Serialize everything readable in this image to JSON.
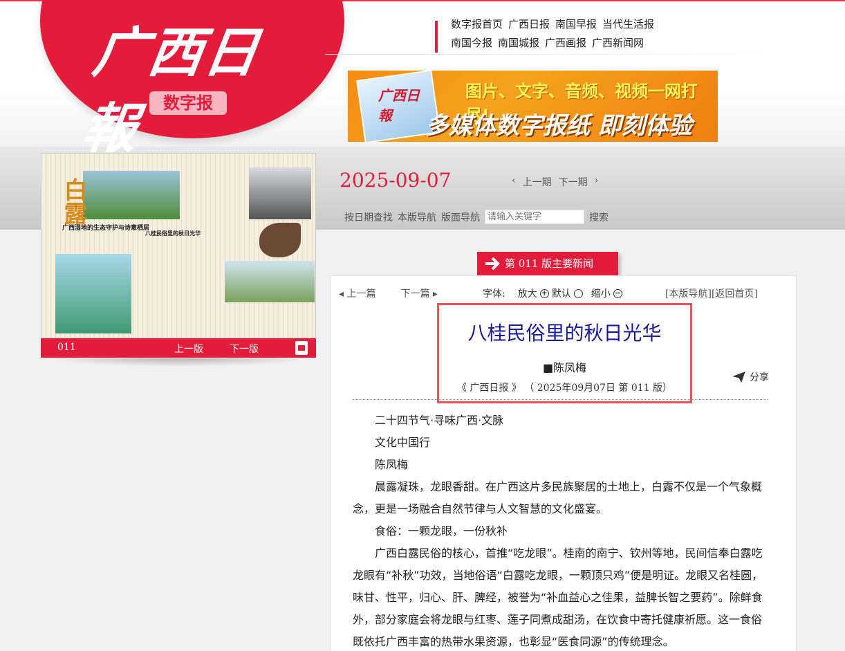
{
  "logo": {
    "title": "广西日報",
    "badge": "数字报"
  },
  "nav": {
    "row1": [
      "数字报首页",
      "广西日报",
      "南国早报",
      "当代生活报"
    ],
    "row2": [
      "南国今报",
      "南国城报",
      "广西画报",
      "广西新闻网"
    ]
  },
  "banner": {
    "mark": "广西日報",
    "line1": "图片、文字、音频、视频一网打尽!",
    "line2": "多媒体数字报纸  即刻体验"
  },
  "thumbnail": {
    "headline": "广西湿地的生态守护与诗意栖居",
    "subheadline": "八桂民俗里的秋日光华",
    "seasonal_char": "白露",
    "page_no": "011",
    "prev_label": "上一版",
    "next_label": "下一版"
  },
  "date": "2025-09-07",
  "period_nav": {
    "prev": "上一期",
    "next": "下一期"
  },
  "search": {
    "by_date": "按日期查找",
    "this_page": "本版导航",
    "page_nav": "版面导航",
    "placeholder": "请输入关键字",
    "button": "搜索"
  },
  "edition_tab": "第 011 版主要新闻",
  "article_nav": {
    "prev": "上一篇",
    "next": "下一篇"
  },
  "font_controls": {
    "label": "字体:",
    "enlarge": "放大",
    "default": "默认",
    "shrink": "缩小"
  },
  "right_links": {
    "page_nav": "[本版导航]",
    "home": "[返回首页]"
  },
  "article": {
    "title": "八桂民俗里的秋日光华",
    "author": "■陈凤梅",
    "source": "《 广西日报 》 （ 2025年09月07日   第 011 版）",
    "share": "分享",
    "paragraphs": [
      "二十四节气·寻味广西·文脉",
      "文化中国行",
      "陈凤梅",
      "晨露凝珠，龙眼香甜。在广西这片多民族聚居的土地上，白露不仅是一个气象概念，更是一场融合自然节律与人文智慧的文化盛宴。",
      "食俗：一颗龙眼，一份秋补",
      "广西白露民俗的核心，首推“吃龙眼”。桂南的南宁、钦州等地，民间信奉白露吃龙眼有“补秋”功效，当地俗语“白露吃龙眼，一颗顶只鸡”便是明证。龙眼又名桂圆，味甘、性平，归心、肝、脾经，被誉为“补血益心之佳果，益脾长智之要药”。除鲜食外，部分家庭会将龙眼与红枣、莲子同煮成甜汤，在饮食中寄托健康祈愿。这一食俗既依托广西丰富的热带水果资源，也彰显“医食同源”的传统理念。"
    ]
  },
  "colors": {
    "brand_red": "#e41c3c",
    "title_blue": "#1a1aa0",
    "highlight": "#f05454"
  }
}
